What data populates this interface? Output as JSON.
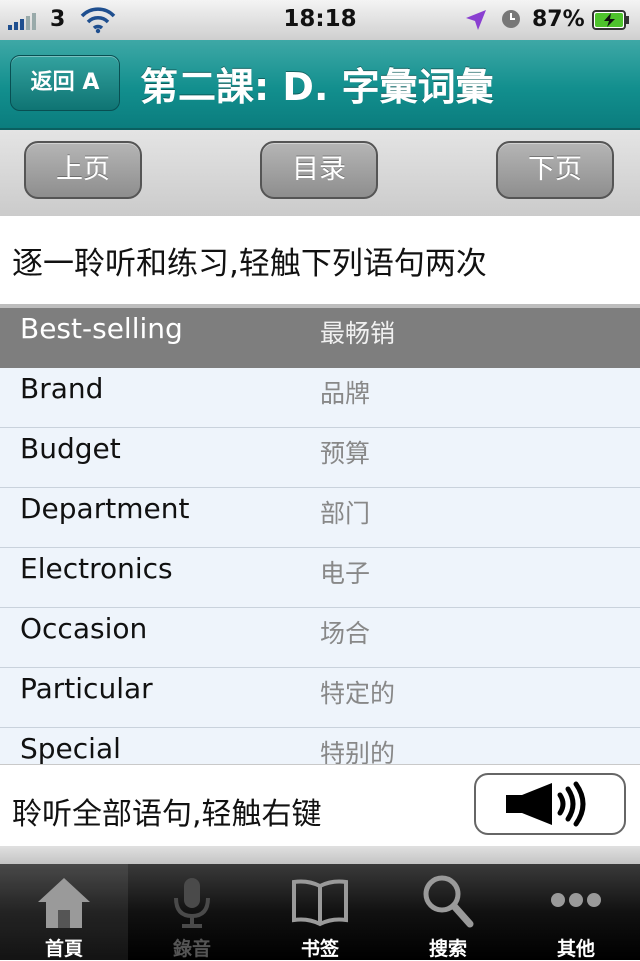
{
  "status_bar": {
    "carrier": "3",
    "time": "18:18",
    "battery": "87%"
  },
  "nav": {
    "back_label": "返回 A",
    "title": "第二課: D. 字彙词彙"
  },
  "toolbar": {
    "prev_label": "上页",
    "toc_label": "目录",
    "next_label": "下页"
  },
  "instruction": "逐一聆听和练习,轻触下列语句两次",
  "vocab": [
    {
      "en": "Best-selling",
      "zh": "最畅销"
    },
    {
      "en": "Brand",
      "zh": "品牌"
    },
    {
      "en": "Budget",
      "zh": "预算"
    },
    {
      "en": "Department",
      "zh": "部门"
    },
    {
      "en": "Electronics",
      "zh": "电子"
    },
    {
      "en": "Occasion",
      "zh": "场合"
    },
    {
      "en": "Particular",
      "zh": "特定的"
    },
    {
      "en": "Special",
      "zh": "特别的"
    }
  ],
  "play_all": {
    "label": "聆听全部语句,轻触右键",
    "button_icon": "speaker-icon"
  },
  "tabs": [
    {
      "label": "首頁",
      "icon": "home-icon"
    },
    {
      "label": "錄音",
      "icon": "microphone-icon"
    },
    {
      "label": "书签",
      "icon": "book-icon"
    },
    {
      "label": "搜索",
      "icon": "search-icon"
    },
    {
      "label": "其他",
      "icon": "more-icon"
    }
  ],
  "colors": {
    "nav_teal": "#128f8e",
    "selected_row": "#7e7e7e",
    "row_bg": "#eef4fb"
  }
}
